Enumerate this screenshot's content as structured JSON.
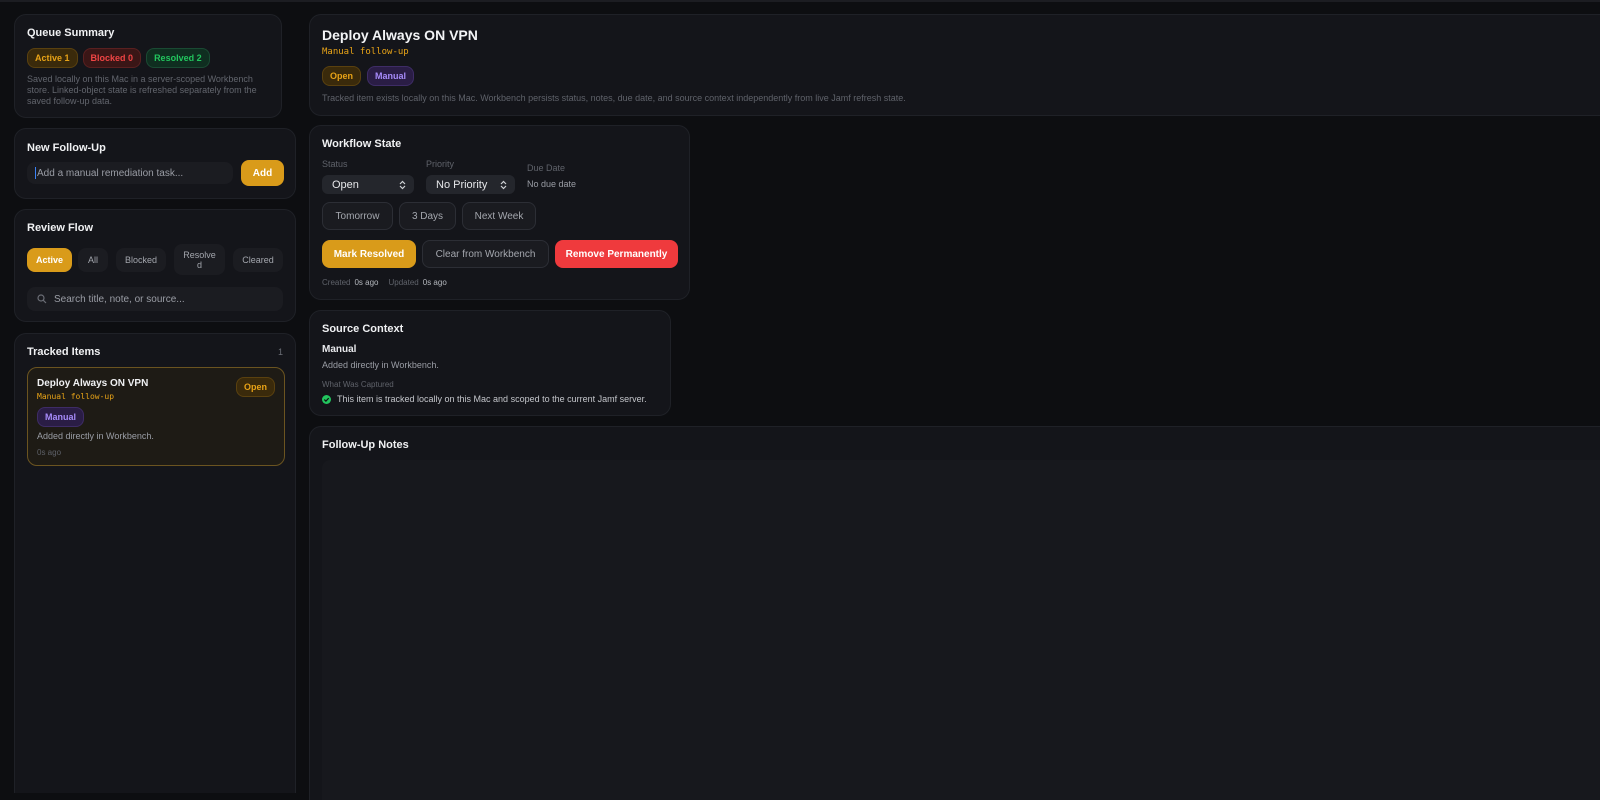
{
  "queue": {
    "title": "Queue Summary",
    "active": "Active 1",
    "blocked": "Blocked 0",
    "resolved": "Resolved 2",
    "description": "Saved locally on this Mac in a server-scoped Workbench store. Linked-object state is refreshed separately from the saved follow-up data."
  },
  "new_followup": {
    "title": "New Follow-Up",
    "placeholder": "Add a manual remediation task...",
    "add_label": "Add"
  },
  "review": {
    "title": "Review Flow",
    "tabs": [
      "Active",
      "All",
      "Blocked",
      "Resolve\nd",
      "Cleared"
    ],
    "search_placeholder": "Search title, note, or source..."
  },
  "tracked": {
    "title": "Tracked Items",
    "count": "1",
    "items": [
      {
        "title": "Deploy Always ON VPN",
        "subtitle": "Manual follow-up",
        "status": "Open",
        "tag": "Manual",
        "description": "Added directly in Workbench.",
        "time": "0s ago"
      }
    ]
  },
  "detail": {
    "title": "Deploy Always ON VPN",
    "subtitle": "Manual follow-up",
    "status_badge": "Open",
    "tag_badge": "Manual",
    "description": "Tracked item exists locally on this Mac. Workbench persists status, notes, due date, and source context independently from live Jamf refresh state."
  },
  "workflow": {
    "title": "Workflow State",
    "status_label": "Status",
    "status_value": "Open",
    "priority_label": "Priority",
    "priority_value": "No Priority",
    "due_label": "Due Date",
    "due_value": "No due date",
    "quick_dates": [
      "Tomorrow",
      "3 Days",
      "Next Week"
    ],
    "mark_resolved": "Mark Resolved",
    "clear": "Clear from Workbench",
    "remove": "Remove Permanently",
    "created_label": "Created",
    "created_value": "0s ago",
    "updated_label": "Updated",
    "updated_value": "0s ago"
  },
  "source": {
    "title": "Source Context",
    "kind": "Manual",
    "kind_desc": "Added directly in Workbench.",
    "captured_label": "What Was Captured",
    "captured_text": "This item is tracked locally on this Mac and scoped to the current Jamf server."
  },
  "notes": {
    "title": "Follow-Up Notes"
  },
  "colors": {
    "accent": "#d99b1a",
    "danger": "#ef4444",
    "success": "#22c55e",
    "purple": "#a78bfa"
  }
}
